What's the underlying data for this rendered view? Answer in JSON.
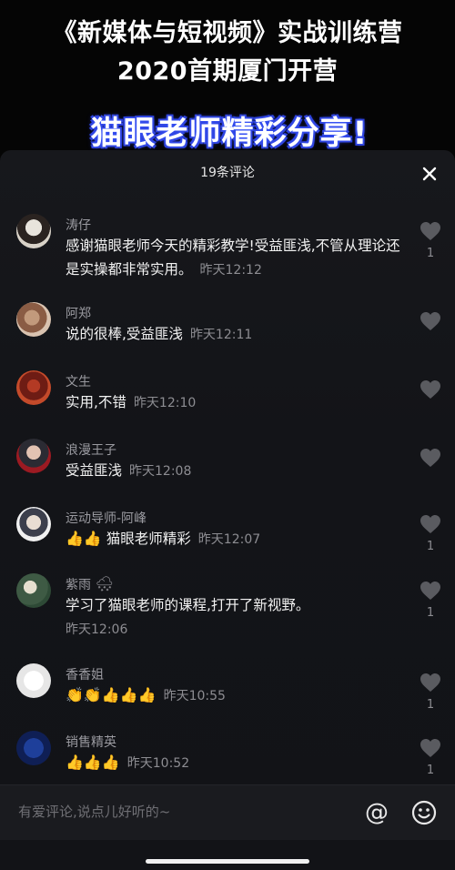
{
  "video": {
    "title_line1": "《新媒体与短视频》实战训练营",
    "title_line2": "2020首期厦门开营",
    "banner": "猫眼老师精彩分享!"
  },
  "sheet": {
    "title": "19条评论",
    "close_icon": "close-icon"
  },
  "comments": [
    {
      "name": "涛仔",
      "text": "感谢猫眼老师今天的精彩教学!受益匪浅,不管从理论还是实操都非常实用。",
      "time": "昨天12:12",
      "likes": "1"
    },
    {
      "name": "阿郑",
      "text": "说的很棒,受益匪浅",
      "time": "昨天12:11",
      "likes": ""
    },
    {
      "name": "文生",
      "text": "实用,不错",
      "time": "昨天12:10",
      "likes": ""
    },
    {
      "name": "浪漫王子",
      "text": "受益匪浅",
      "time": "昨天12:08",
      "likes": ""
    },
    {
      "name": "运动导师-阿峰",
      "emojis": "👍👍",
      "text": "猫眼老师精彩",
      "time": "昨天12:07",
      "likes": "1"
    },
    {
      "name": "紫雨",
      "name_emoji": "🌨",
      "text": "学习了猫眼老师的课程,打开了新视野。",
      "time": "昨天12:06",
      "likes": "1"
    },
    {
      "name": "香香姐",
      "emojis": "👏👏👍👍👍",
      "text": "",
      "time": "昨天10:55",
      "likes": "1"
    },
    {
      "name": "销售精英",
      "emojis": "👍👍👍",
      "text": "",
      "time": "昨天10:52",
      "likes": "1"
    }
  ],
  "input": {
    "placeholder": "有爱评论,说点儿好听的~",
    "at_label": "@"
  },
  "colors": {
    "sheet_bg": "#131418",
    "banner_glow": "#2f43d8",
    "muted_text": "#8d8d92"
  }
}
